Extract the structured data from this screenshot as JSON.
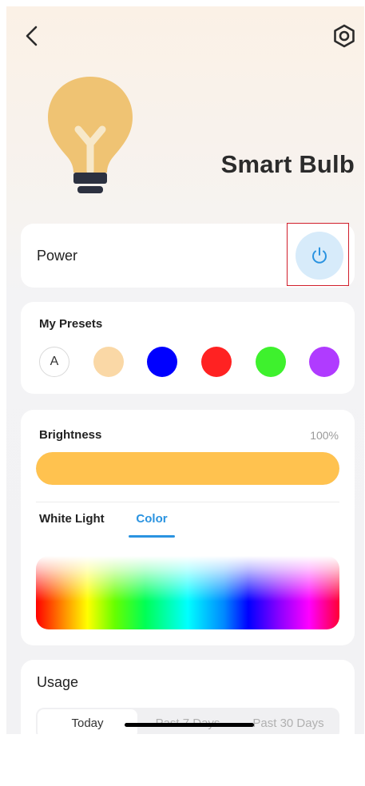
{
  "header": {
    "title": "Smart Bulb",
    "back_icon": "chevron-left-icon",
    "settings_icon": "gear-icon"
  },
  "device": {
    "icon": "lightbulb-icon",
    "bulb_color": "#efc373",
    "filament_color": "#f7e8c9",
    "base_color": "#2c3140"
  },
  "power": {
    "label": "Power",
    "icon": "power-icon",
    "button_bg": "#d7ebfa",
    "icon_color": "#2a93e0"
  },
  "presets": {
    "label": "My Presets",
    "auto_label": "A",
    "colors": [
      "#fad8a6",
      "#0000ff",
      "#ff2222",
      "#3ef12d",
      "#b03bff"
    ]
  },
  "brightness": {
    "label": "Brightness",
    "value_text": "100%",
    "level": 1.0,
    "fill_color": "#ffc24f"
  },
  "light_tabs": {
    "tabs": [
      "White Light",
      "Color"
    ],
    "selected": "Color",
    "accent": "#2a93e0"
  },
  "usage": {
    "label": "Usage",
    "periods": [
      "Today",
      "Past 7 Days",
      "Past 30 Days"
    ],
    "selected": "Today"
  }
}
